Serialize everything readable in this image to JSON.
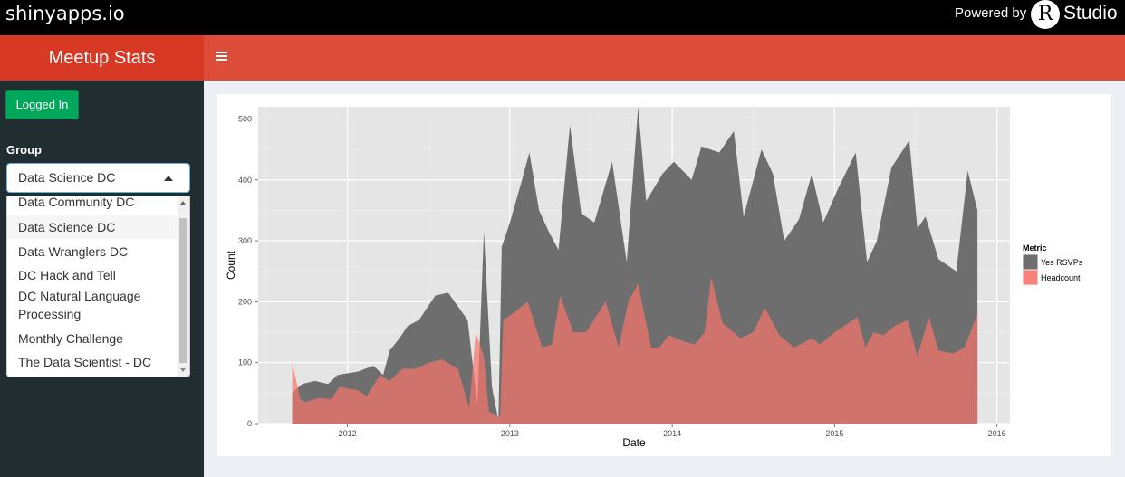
{
  "topbar": {
    "brand": "shinyapps.io",
    "powered_by": "Powered by",
    "r_letter": "R",
    "studio": "Studio"
  },
  "header": {
    "title": "Meetup Stats",
    "toggle_icon": "hamburger-icon"
  },
  "sidebar": {
    "login_button": "Logged In",
    "group_label": "Group",
    "selected": "Data Science DC",
    "options": [
      "Data Community DC",
      "Data Science DC",
      "Data Wranglers DC",
      "DC Hack and Tell",
      "DC Natural Language",
      "Processing",
      "Monthly Challenge",
      "The Data Scientist - DC"
    ]
  },
  "colors": {
    "header": "#dd4b39",
    "logo_bg": "#d73925",
    "sidebar": "#222d32",
    "login": "#00a65a",
    "yes_rsvps": "#6e6e6e",
    "headcount": "#f8766d"
  },
  "chart_data": {
    "type": "area",
    "xlabel": "Date",
    "ylabel": "Count",
    "x_ticks": [
      "2012",
      "2013",
      "2014",
      "2015",
      "2016"
    ],
    "y_ticks": [
      "0",
      "100",
      "200",
      "300",
      "400",
      "500"
    ],
    "ylim": [
      0,
      520
    ],
    "xlim": [
      2011.45,
      2016.08
    ],
    "legend": {
      "title": "Metric",
      "position": "right",
      "entries": [
        "Yes RSVPs",
        "Headcount"
      ]
    },
    "grid": true,
    "series": [
      {
        "name": "Yes RSVPs",
        "color": "#6e6e6e",
        "points": [
          [
            2011.66,
            50
          ],
          [
            2011.72,
            65
          ],
          [
            2011.8,
            70
          ],
          [
            2011.88,
            65
          ],
          [
            2011.94,
            80
          ],
          [
            2012.06,
            85
          ],
          [
            2012.16,
            95
          ],
          [
            2012.22,
            80
          ],
          [
            2012.26,
            120
          ],
          [
            2012.32,
            140
          ],
          [
            2012.37,
            160
          ],
          [
            2012.44,
            170
          ],
          [
            2012.54,
            210
          ],
          [
            2012.62,
            215
          ],
          [
            2012.74,
            170
          ],
          [
            2012.8,
            30
          ],
          [
            2012.84,
            315
          ],
          [
            2012.89,
            60
          ],
          [
            2012.93,
            5
          ],
          [
            2012.95,
            290
          ],
          [
            2013.0,
            330
          ],
          [
            2013.07,
            395
          ],
          [
            2013.12,
            445
          ],
          [
            2013.18,
            350
          ],
          [
            2013.24,
            315
          ],
          [
            2013.3,
            285
          ],
          [
            2013.37,
            490
          ],
          [
            2013.44,
            345
          ],
          [
            2013.52,
            330
          ],
          [
            2013.63,
            430
          ],
          [
            2013.72,
            265
          ],
          [
            2013.79,
            520
          ],
          [
            2013.84,
            365
          ],
          [
            2013.94,
            410
          ],
          [
            2014.01,
            430
          ],
          [
            2014.12,
            400
          ],
          [
            2014.18,
            455
          ],
          [
            2014.29,
            445
          ],
          [
            2014.38,
            480
          ],
          [
            2014.44,
            340
          ],
          [
            2014.55,
            450
          ],
          [
            2014.62,
            410
          ],
          [
            2014.69,
            300
          ],
          [
            2014.78,
            335
          ],
          [
            2014.86,
            410
          ],
          [
            2014.93,
            330
          ],
          [
            2015.02,
            385
          ],
          [
            2015.13,
            445
          ],
          [
            2015.2,
            265
          ],
          [
            2015.26,
            300
          ],
          [
            2015.35,
            420
          ],
          [
            2015.46,
            465
          ],
          [
            2015.51,
            320
          ],
          [
            2015.56,
            340
          ],
          [
            2015.64,
            270
          ],
          [
            2015.75,
            250
          ],
          [
            2015.82,
            415
          ],
          [
            2015.88,
            350
          ]
        ]
      },
      {
        "name": "Headcount",
        "color": "#f8766d",
        "points": [
          [
            2011.66,
            100
          ],
          [
            2011.71,
            40
          ],
          [
            2011.74,
            35
          ],
          [
            2011.82,
            42
          ],
          [
            2011.9,
            40
          ],
          [
            2011.95,
            60
          ],
          [
            2012.06,
            55
          ],
          [
            2012.12,
            45
          ],
          [
            2012.2,
            80
          ],
          [
            2012.26,
            70
          ],
          [
            2012.34,
            90
          ],
          [
            2012.42,
            90
          ],
          [
            2012.5,
            100
          ],
          [
            2012.58,
            105
          ],
          [
            2012.68,
            90
          ],
          [
            2012.75,
            25
          ],
          [
            2012.79,
            150
          ],
          [
            2012.84,
            110
          ],
          [
            2012.87,
            20
          ],
          [
            2012.94,
            10
          ],
          [
            2012.96,
            170
          ],
          [
            2013.04,
            185
          ],
          [
            2013.11,
            200
          ],
          [
            2013.2,
            125
          ],
          [
            2013.26,
            130
          ],
          [
            2013.31,
            210
          ],
          [
            2013.39,
            150
          ],
          [
            2013.47,
            150
          ],
          [
            2013.59,
            200
          ],
          [
            2013.67,
            125
          ],
          [
            2013.73,
            200
          ],
          [
            2013.79,
            230
          ],
          [
            2013.87,
            125
          ],
          [
            2013.92,
            125
          ],
          [
            2013.98,
            145
          ],
          [
            2014.07,
            135
          ],
          [
            2014.14,
            130
          ],
          [
            2014.2,
            150
          ],
          [
            2014.24,
            240
          ],
          [
            2014.31,
            165
          ],
          [
            2014.42,
            140
          ],
          [
            2014.5,
            150
          ],
          [
            2014.57,
            190
          ],
          [
            2014.66,
            145
          ],
          [
            2014.75,
            125
          ],
          [
            2014.86,
            140
          ],
          [
            2014.91,
            130
          ],
          [
            2015.0,
            150
          ],
          [
            2015.06,
            160
          ],
          [
            2015.14,
            175
          ],
          [
            2015.19,
            125
          ],
          [
            2015.24,
            150
          ],
          [
            2015.3,
            145
          ],
          [
            2015.37,
            160
          ],
          [
            2015.45,
            170
          ],
          [
            2015.51,
            110
          ],
          [
            2015.58,
            175
          ],
          [
            2015.64,
            120
          ],
          [
            2015.73,
            115
          ],
          [
            2015.8,
            125
          ],
          [
            2015.88,
            180
          ]
        ]
      }
    ]
  }
}
